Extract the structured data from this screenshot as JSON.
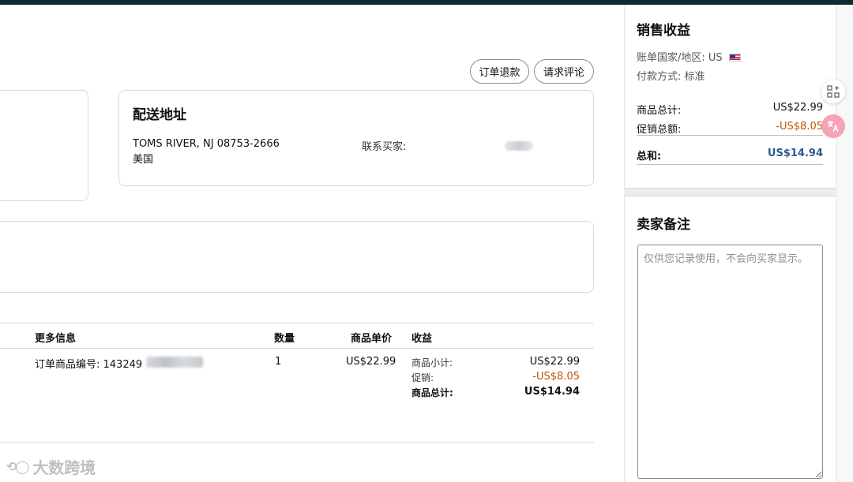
{
  "actions": {
    "refund_label": "订单退款",
    "review_label": "请求评论"
  },
  "shipping": {
    "title": "配送地址",
    "address_line": "TOMS RIVER, NJ 08753-2666",
    "country": "美国",
    "contact_label": "联系买家:"
  },
  "table": {
    "headers": {
      "more_info": "更多信息",
      "quantity": "数量",
      "unit_price": "商品单价",
      "income": "收益"
    },
    "row": {
      "order_item_id": "订单商品编号: 143249",
      "quantity": "1",
      "unit_price": "US$22.99",
      "subtotal_label": "商品小计:",
      "subtotal_value": "US$22.99",
      "promo_label": "促销:",
      "promo_value": "-US$8.05",
      "total_label": "商品总计:",
      "total_value": "US$14.94"
    }
  },
  "sales": {
    "title": "销售收益",
    "country_line": "账单国家/地区: US",
    "payment_line": "付款方式: 标准",
    "goods_total_label": "商品总计:",
    "goods_total_value": "US$22.99",
    "promo_total_label": "促销总额:",
    "promo_total_value": "-US$8.05",
    "sum_label": "总和:",
    "sum_value": "US$14.94"
  },
  "notes": {
    "title": "卖家备注",
    "placeholder": "仅供您记录使用，不会向买家显示。"
  },
  "watermark": {
    "text": "大数跨境"
  },
  "colors": {
    "topbar": "#0c2b33",
    "promo": "#c45500",
    "total": "#2e5c8a"
  }
}
